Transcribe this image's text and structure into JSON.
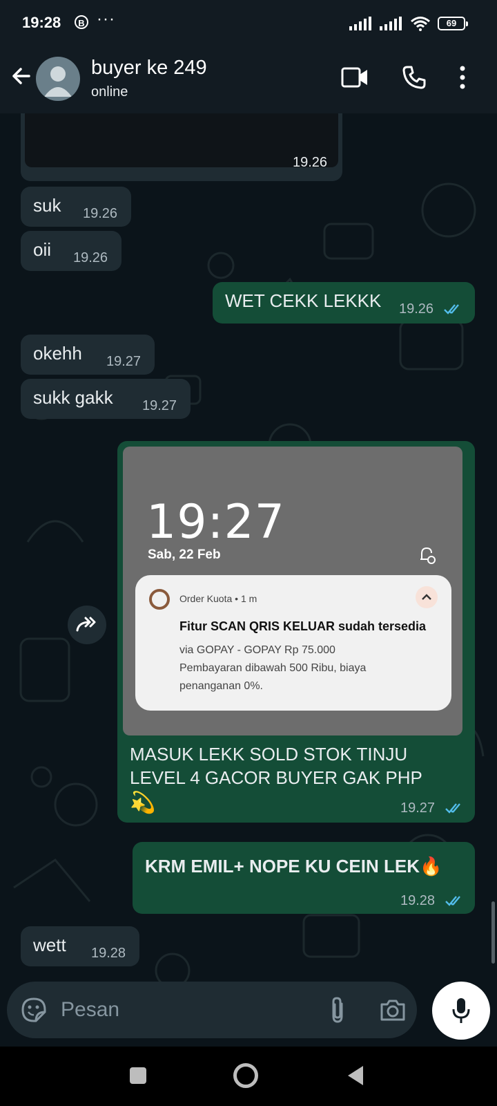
{
  "status_bar": {
    "time": "19:28",
    "badge": "B",
    "dots": "···",
    "battery": "69"
  },
  "header": {
    "contact_name": "buyer ke 249",
    "contact_status": "online"
  },
  "messages": [
    {
      "text": "",
      "time": "19.26",
      "dir": "in"
    },
    {
      "text": "suk",
      "time": "19.26",
      "dir": "in"
    },
    {
      "text": "oii",
      "time": "19.26",
      "dir": "in"
    },
    {
      "text": "WET CEKK LEKKK",
      "time": "19.26",
      "dir": "out"
    },
    {
      "text": "okehh",
      "time": "19.27",
      "dir": "in"
    },
    {
      "text": "sukk gakk",
      "time": "19.27",
      "dir": "in"
    },
    {
      "text_line1": "MASUK LEKK SOLD STOK TINJU",
      "text_line2": "LEVEL 4 GACOR BUYER GAK PHP",
      "emoji": "💫",
      "time": "19.27",
      "dir": "out"
    },
    {
      "text": "KRM EMIL+ NOPE KU CEIN LEK🔥",
      "time": "19.28",
      "dir": "out"
    },
    {
      "text": "wett",
      "time": "19.28",
      "dir": "in"
    }
  ],
  "screenshot": {
    "lock_time": "19:27",
    "lock_date": "Sab, 22 Feb",
    "notification": {
      "app": "Order Kuota • 1 m",
      "title": "Fitur SCAN QRIS KELUAR sudah tersedia",
      "body1": "via GOPAY - GOPAY Rp 75.000",
      "body2": "Pembayaran dibawah 500 Ribu, biaya",
      "body3": "penanganan 0%."
    }
  },
  "composer": {
    "placeholder": "Pesan"
  },
  "colors": {
    "incoming": "#1f2c33",
    "outgoing": "#144d37",
    "read_ticks": "#53bdeb",
    "background": "#0b141a"
  }
}
